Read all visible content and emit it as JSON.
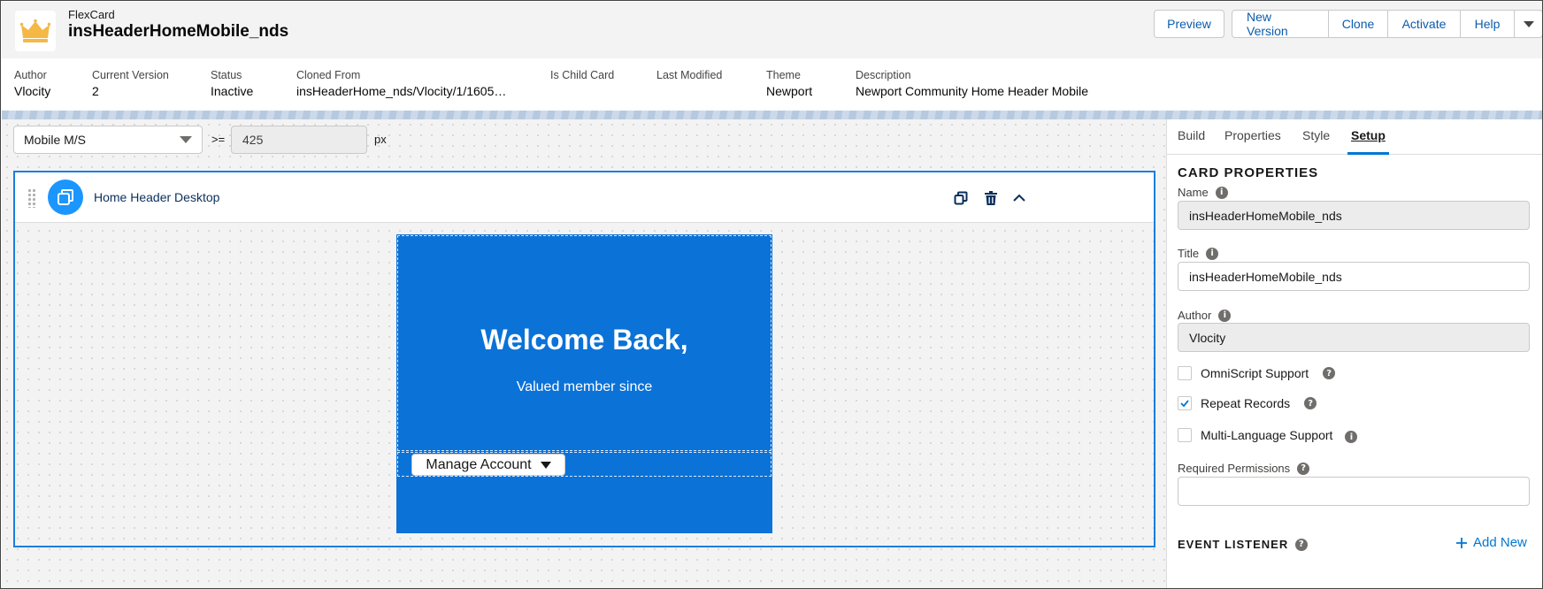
{
  "header": {
    "object_type": "FlexCard",
    "record_name": "insHeaderHomeMobile_nds",
    "buttons": {
      "preview": "Preview",
      "new_version": "New Version",
      "clone": "Clone",
      "activate": "Activate",
      "help": "Help"
    }
  },
  "meta": {
    "author": {
      "label": "Author",
      "value": "Vlocity"
    },
    "current_version": {
      "label": "Current Version",
      "value": "2"
    },
    "status": {
      "label": "Status",
      "value": "Inactive"
    },
    "cloned_from": {
      "label": "Cloned From",
      "value": "insHeaderHome_nds/Vlocity/1/1605…"
    },
    "is_child_card": {
      "label": "Is Child Card",
      "value": ""
    },
    "last_modified": {
      "label": "Last Modified",
      "value": ""
    },
    "theme": {
      "label": "Theme",
      "value": "Newport"
    },
    "description": {
      "label": "Description",
      "value": "Newport Community Home Header Mobile"
    }
  },
  "canvas": {
    "device": "Mobile M/S",
    "operator": ">=",
    "breakpoint": "425",
    "unit": "px",
    "card_title": "Home Header Desktop",
    "preview": {
      "heading": "Welcome Back,",
      "subtext": "Valued member since",
      "button_label": "Manage Account"
    }
  },
  "panel": {
    "tabs": [
      "Build",
      "Properties",
      "Style",
      "Setup"
    ],
    "active_tab": "Setup",
    "section_title": "CARD PROPERTIES",
    "name": {
      "label": "Name",
      "value": "insHeaderHomeMobile_nds"
    },
    "title": {
      "label": "Title",
      "value": "insHeaderHomeMobile_nds"
    },
    "author": {
      "label": "Author",
      "value": "Vlocity"
    },
    "omniscript_support": {
      "label": "OmniScript Support",
      "checked": false
    },
    "repeat_records": {
      "label": "Repeat Records",
      "checked": true
    },
    "multi_language": {
      "label": "Multi-Language Support",
      "checked": false
    },
    "required_permissions": {
      "label": "Required Permissions",
      "value": ""
    },
    "event_listener": {
      "title": "EVENT LISTENER",
      "add_label": "Add New"
    }
  },
  "colors": {
    "brand": "#0176d3",
    "preview_bg": "#0b72d8",
    "card_icon": "#1b96ff",
    "crown": "#f4b844"
  }
}
